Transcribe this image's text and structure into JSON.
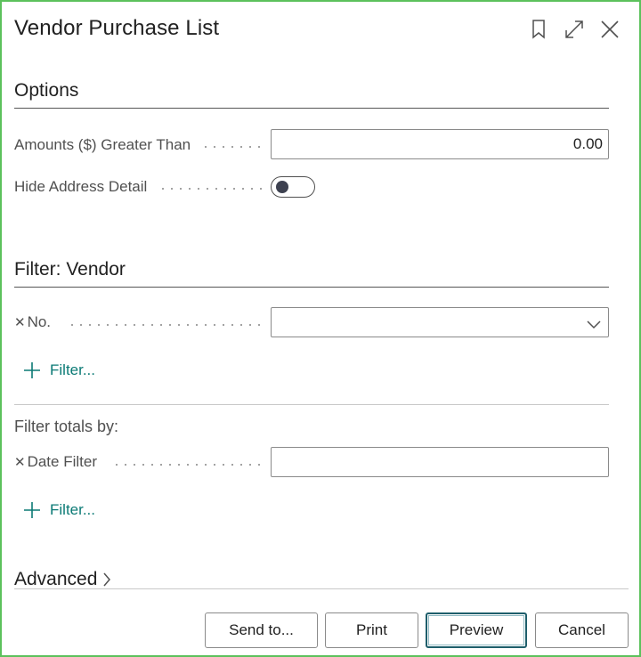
{
  "dialog": {
    "title": "Vendor Purchase List",
    "icons": [
      "bookmark-icon",
      "expand-icon",
      "close-icon"
    ]
  },
  "options": {
    "title": "Options",
    "amounts_label": "Amounts ($) Greater Than",
    "amounts_value": "0.00",
    "hide_address_label": "Hide Address Detail",
    "hide_address_on": false
  },
  "filter_vendor": {
    "title": "Filter: Vendor",
    "no_label": "No.",
    "no_value": "",
    "filter_link": "Filter..."
  },
  "filter_totals": {
    "title": "Filter totals by:",
    "date_filter_label": "Date Filter",
    "date_filter_value": "",
    "filter_link": "Filter..."
  },
  "advanced": {
    "label": "Advanced"
  },
  "footer": {
    "send_to": "Send to...",
    "print": "Print",
    "preview": "Preview",
    "cancel": "Cancel"
  },
  "colors": {
    "accent_teal": "#0b7a75",
    "window_border": "#5cc15c",
    "primary_button_border": "#1e5e6b"
  }
}
